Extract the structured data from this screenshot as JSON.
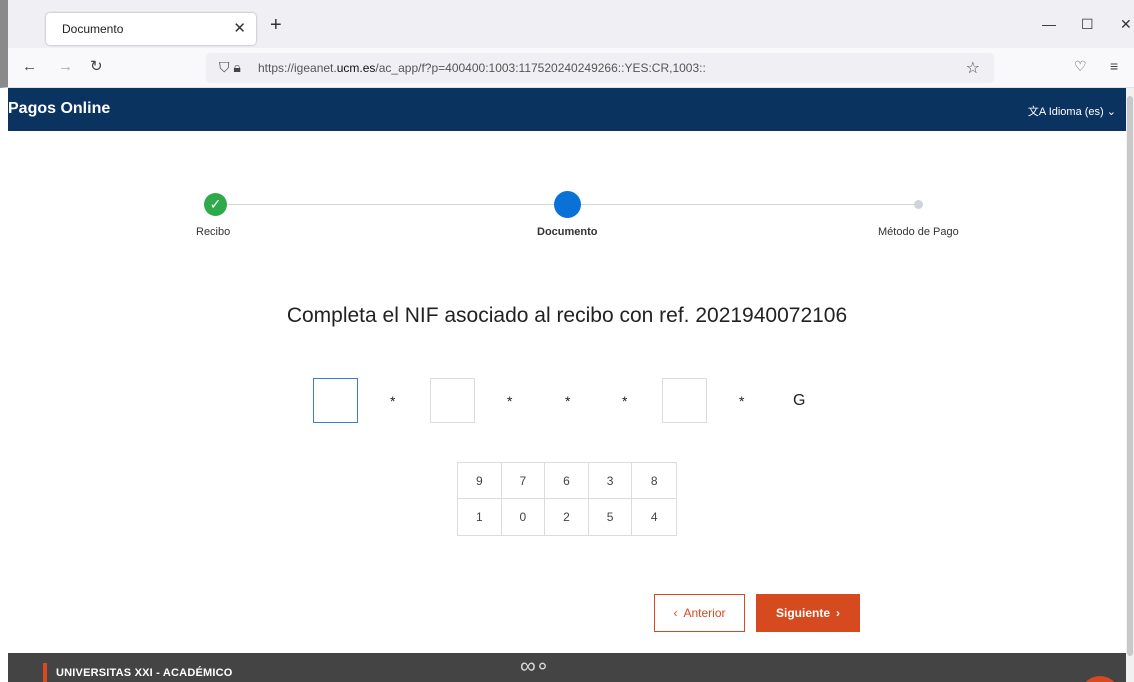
{
  "browser": {
    "tab_title": "Documento",
    "url_prefix": "https://igeanet.",
    "url_domain": "ucm.es",
    "url_path": "/ac_app/f?p=400400:1003:117520240249266::YES:CR,1003::"
  },
  "header": {
    "brand": "Pagos Online",
    "language": "Idioma (es)"
  },
  "stepper": {
    "steps": [
      {
        "label": "Recibo",
        "state": "done"
      },
      {
        "label": "Documento",
        "state": "active"
      },
      {
        "label": "Método de Pago",
        "state": "pending"
      }
    ]
  },
  "main": {
    "question": "Completa el NIF asociado al recibo con ref. 2021940072106",
    "nif_mask": [
      "",
      "*",
      "",
      "*",
      "*",
      "*",
      "",
      "*",
      "G"
    ],
    "keypad": [
      "9",
      "7",
      "6",
      "3",
      "8",
      "1",
      "0",
      "2",
      "5",
      "4"
    ],
    "prev_label": "Anterior",
    "next_label": "Siguiente"
  },
  "footer": {
    "text": "UNIVERSITAS XXI - ACADÉMICO"
  },
  "colors": {
    "header_bg": "#0b3360",
    "accent": "#d54a1f",
    "step_done": "#2eaa4a",
    "step_active": "#0a72d6"
  }
}
